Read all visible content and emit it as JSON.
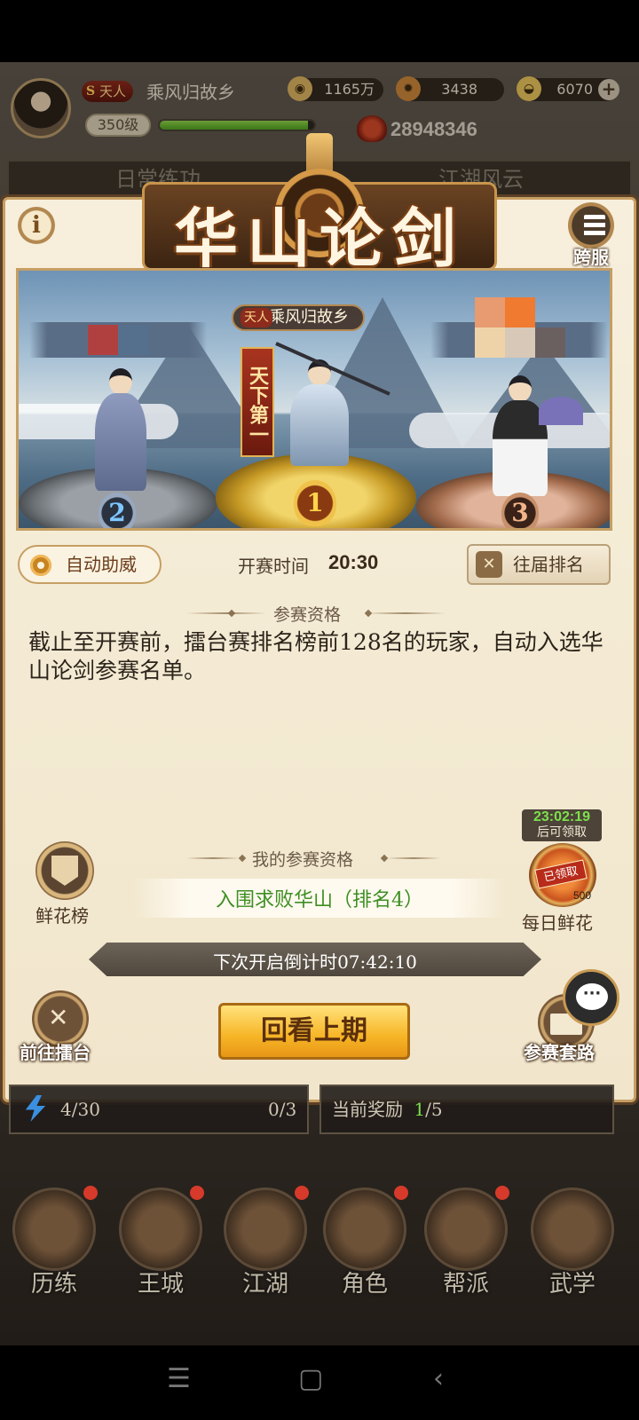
{
  "player": {
    "title_badge": "天人",
    "name": "乘风归故乡",
    "level": "350级",
    "xp_progress": 0.96,
    "power": "28948346"
  },
  "resources": {
    "coins": "1165万",
    "gems": "3438",
    "ingots": "6070"
  },
  "background_tabs": [
    "日常练功",
    "江湖风云"
  ],
  "dialog": {
    "title": "华山论剑",
    "cross_server_label": "跨服",
    "arena": {
      "winner_title": "天人",
      "winner_name": "乘风归故乡",
      "champion_tag": "天下第一",
      "ranks": [
        "1",
        "2",
        "3"
      ]
    },
    "auto_cheer_label": "自动助威",
    "start_time_label": "开赛时间",
    "start_time_value": "20:30",
    "past_rankings_label": "往届排名",
    "qualification_title": "参赛资格",
    "qualification_desc": "截止至开赛前，擂台赛排名榜前128名的玩家，自动入选华山论剑参赛名单。",
    "my_qualification_title": "我的参赛资格",
    "my_qualification_value": "入围求败华山（排名4）",
    "flower_list_label": "鲜花榜",
    "daily_flower": {
      "timer": "23:02:19",
      "timer_suffix": "后可领取",
      "claimed_label": "已领取",
      "count": "500",
      "label": "每日鲜花"
    },
    "countdown_text": "下次开启倒计时07:42:10",
    "replay_button": "回看上期",
    "go_arena_label": "前往擂台",
    "strategy_label": "参赛套路"
  },
  "bottom_stats": {
    "energy": "4/30",
    "middle": "0/3",
    "reward_label": "当前奖励",
    "reward_current": "1",
    "reward_total": "/5"
  },
  "nav": [
    "历练",
    "王城",
    "江湖",
    "角色",
    "帮派",
    "武学"
  ],
  "colors": {
    "accent_gold": "#f7b526",
    "dialog_bg": "#f4ead4",
    "qualification_green": "#3d8f22",
    "timer_green": "#7be04c"
  }
}
